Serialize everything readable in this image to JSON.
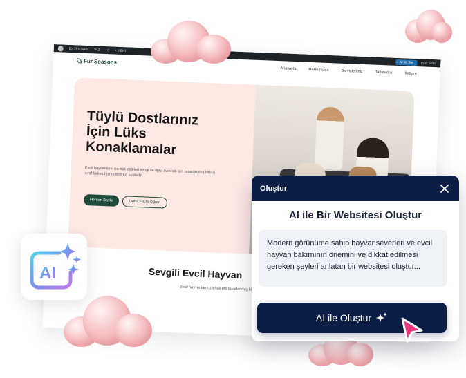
{
  "admin_bar": {
    "site_name": "EXTENDIFY",
    "update_count": "2",
    "comment_count": "0",
    "new_label": "+ YENİ",
    "ai_button": "AI ile Sor",
    "user_label": "Fürr Seba"
  },
  "site": {
    "brand": "Fur Seasons",
    "menu": [
      "Anasayfa",
      "Hakkımızda",
      "Servislerimiz",
      "Takımımız",
      "İletişim"
    ],
    "hero_title": "Tüylü Dostlarınız İçin Lüks Konaklamalar",
    "hero_description": "Evcil hayvanlarınıza hak ettikleri sevgi ve ilgiyi sunmak için tasarlanmış birinci sınıf bakım hizmetlerimizi keşfedin.",
    "primary_button": "Hemen Başla",
    "secondary_button": "Daha Fazla Öğren",
    "section_title": "Sevgili Evcil Hayvan",
    "section_description": "Evcil hayvanlarınıza hak etti tasarlanmış birinci sınıf bak"
  },
  "badge": {
    "label": "AI",
    "icon": "ai-sparkle-icon"
  },
  "dialog": {
    "header": "Oluştur",
    "title": "AI ile Bir Websitesi Oluştur",
    "prompt_text": "Modern görünüme sahip hayvanseverleri ve evcil hayvan bakımının önemini ve dikkat edilmesi gereken şeyleri anlatan bir websitesi oluştur...",
    "button_label": "AI ile Oluştur"
  },
  "colors": {
    "navy": "#0c1d46",
    "brand_green": "#1e4a3a",
    "hero_pink": "#fde8e4",
    "pointer_pink": "#e8377c"
  }
}
